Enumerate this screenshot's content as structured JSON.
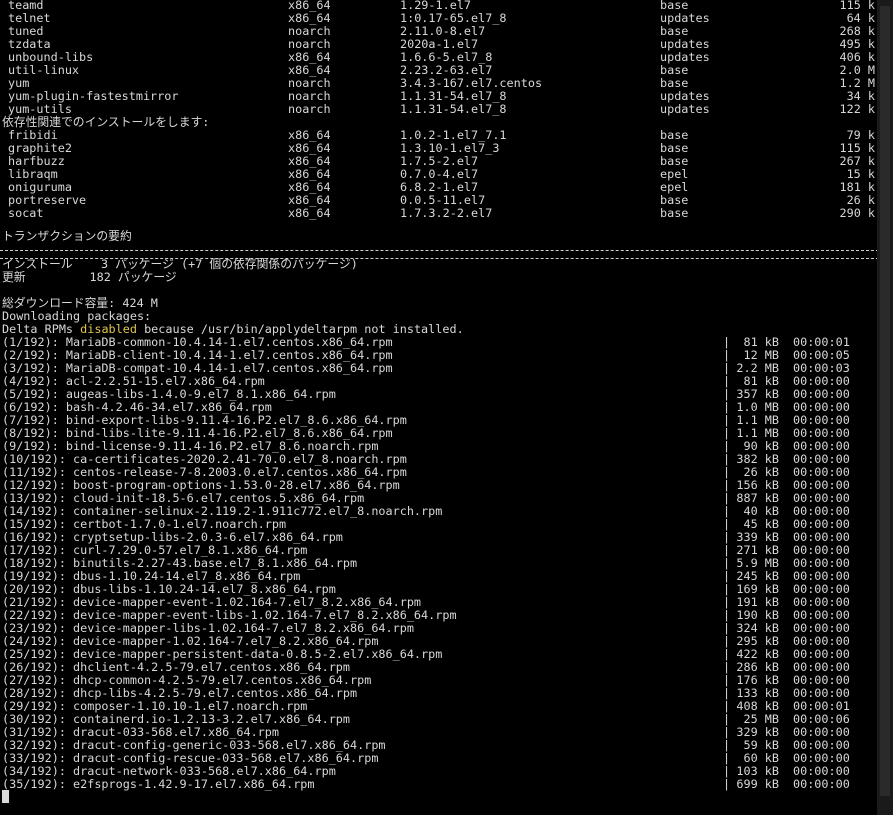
{
  "pkg_rows": [
    {
      "name": "teamd",
      "arch": "x86_64",
      "ver": "1.29-1.el7",
      "repo": "base",
      "size": "115 k"
    },
    {
      "name": "telnet",
      "arch": "x86_64",
      "ver": "1:0.17-65.el7_8",
      "repo": "updates",
      "size": "64 k"
    },
    {
      "name": "tuned",
      "arch": "noarch",
      "ver": "2.11.0-8.el7",
      "repo": "base",
      "size": "268 k"
    },
    {
      "name": "tzdata",
      "arch": "noarch",
      "ver": "2020a-1.el7",
      "repo": "updates",
      "size": "495 k"
    },
    {
      "name": "unbound-libs",
      "arch": "x86_64",
      "ver": "1.6.6-5.el7_8",
      "repo": "updates",
      "size": "406 k"
    },
    {
      "name": "util-linux",
      "arch": "x86_64",
      "ver": "2.23.2-63.el7",
      "repo": "base",
      "size": "2.0 M"
    },
    {
      "name": "yum",
      "arch": "noarch",
      "ver": "3.4.3-167.el7.centos",
      "repo": "base",
      "size": "1.2 M"
    },
    {
      "name": "yum-plugin-fastestmirror",
      "arch": "noarch",
      "ver": "1.1.31-54.el7_8",
      "repo": "updates",
      "size": "34 k"
    },
    {
      "name": "yum-utils",
      "arch": "noarch",
      "ver": "1.1.31-54.el7_8",
      "repo": "updates",
      "size": "122 k"
    }
  ],
  "deps_header": "依存性関連でのインストールをします:",
  "dep_rows": [
    {
      "name": "fribidi",
      "arch": "x86_64",
      "ver": "1.0.2-1.el7_7.1",
      "repo": "base",
      "size": "79 k"
    },
    {
      "name": "graphite2",
      "arch": "x86_64",
      "ver": "1.3.10-1.el7_3",
      "repo": "base",
      "size": "115 k"
    },
    {
      "name": "harfbuzz",
      "arch": "x86_64",
      "ver": "1.7.5-2.el7",
      "repo": "base",
      "size": "267 k"
    },
    {
      "name": "libraqm",
      "arch": "x86_64",
      "ver": "0.7.0-4.el7",
      "repo": "epel",
      "size": "15 k"
    },
    {
      "name": "oniguruma",
      "arch": "x86_64",
      "ver": "6.8.2-1.el7",
      "repo": "epel",
      "size": "181 k"
    },
    {
      "name": "portreserve",
      "arch": "x86_64",
      "ver": "0.0.5-11.el7",
      "repo": "base",
      "size": "26 k"
    },
    {
      "name": "socat",
      "arch": "x86_64",
      "ver": "1.7.3.2-2.el7",
      "repo": "base",
      "size": "290 k"
    }
  ],
  "summary_title": "トランザクションの要約",
  "summary_install": "インストール    3 パッケージ (+7 個の依存関係のパッケージ)",
  "summary_update": "更新         182 パッケージ",
  "total_download": "総ダウンロード容量: 424 M",
  "downloading": "Downloading packages:",
  "delta_pre": "Delta RPMs ",
  "delta_hi": "disabled",
  "delta_post": " because /usr/bin/applydeltarpm not installed.",
  "downloads": [
    {
      "n": "(1/192): MariaDB-common-10.4.14-1.el7.centos.x86_64.rpm",
      "s": "81 kB",
      "t": "00:00:01"
    },
    {
      "n": "(2/192): MariaDB-client-10.4.14-1.el7.centos.x86_64.rpm",
      "s": "12 MB",
      "t": "00:00:05"
    },
    {
      "n": "(3/192): MariaDB-compat-10.4.14-1.el7.centos.x86_64.rpm",
      "s": "2.2 MB",
      "t": "00:00:03"
    },
    {
      "n": "(4/192): acl-2.2.51-15.el7.x86_64.rpm",
      "s": "81 kB",
      "t": "00:00:00"
    },
    {
      "n": "(5/192): augeas-libs-1.4.0-9.el7_8.1.x86_64.rpm",
      "s": "357 kB",
      "t": "00:00:00"
    },
    {
      "n": "(6/192): bash-4.2.46-34.el7.x86_64.rpm",
      "s": "1.0 MB",
      "t": "00:00:00"
    },
    {
      "n": "(7/192): bind-export-libs-9.11.4-16.P2.el7_8.6.x86_64.rpm",
      "s": "1.1 MB",
      "t": "00:00:00"
    },
    {
      "n": "(8/192): bind-libs-lite-9.11.4-16.P2.el7_8.6.x86_64.rpm",
      "s": "1.1 MB",
      "t": "00:00:00"
    },
    {
      "n": "(9/192): bind-license-9.11.4-16.P2.el7_8.6.noarch.rpm",
      "s": "90 kB",
      "t": "00:00:00"
    },
    {
      "n": "(10/192): ca-certificates-2020.2.41-70.0.el7_8.noarch.rpm",
      "s": "382 kB",
      "t": "00:00:00"
    },
    {
      "n": "(11/192): centos-release-7-8.2003.0.el7.centos.x86_64.rpm",
      "s": "26 kB",
      "t": "00:00:00"
    },
    {
      "n": "(12/192): boost-program-options-1.53.0-28.el7.x86_64.rpm",
      "s": "156 kB",
      "t": "00:00:00"
    },
    {
      "n": "(13/192): cloud-init-18.5-6.el7.centos.5.x86_64.rpm",
      "s": "887 kB",
      "t": "00:00:00"
    },
    {
      "n": "(14/192): container-selinux-2.119.2-1.911c772.el7_8.noarch.rpm",
      "s": "40 kB",
      "t": "00:00:00"
    },
    {
      "n": "(15/192): certbot-1.7.0-1.el7.noarch.rpm",
      "s": "45 kB",
      "t": "00:00:00"
    },
    {
      "n": "(16/192): cryptsetup-libs-2.0.3-6.el7.x86_64.rpm",
      "s": "339 kB",
      "t": "00:00:00"
    },
    {
      "n": "(17/192): curl-7.29.0-57.el7_8.1.x86_64.rpm",
      "s": "271 kB",
      "t": "00:00:00"
    },
    {
      "n": "(18/192): binutils-2.27-43.base.el7_8.1.x86_64.rpm",
      "s": "5.9 MB",
      "t": "00:00:00"
    },
    {
      "n": "(19/192): dbus-1.10.24-14.el7_8.x86_64.rpm",
      "s": "245 kB",
      "t": "00:00:00"
    },
    {
      "n": "(20/192): dbus-libs-1.10.24-14.el7_8.x86_64.rpm",
      "s": "169 kB",
      "t": "00:00:00"
    },
    {
      "n": "(21/192): device-mapper-event-1.02.164-7.el7_8.2.x86_64.rpm",
      "s": "191 kB",
      "t": "00:00:00"
    },
    {
      "n": "(22/192): device-mapper-event-libs-1.02.164-7.el7_8.2.x86_64.rpm",
      "s": "190 kB",
      "t": "00:00:00"
    },
    {
      "n": "(23/192): device-mapper-libs-1.02.164-7.el7_8.2.x86_64.rpm",
      "s": "324 kB",
      "t": "00:00:00"
    },
    {
      "n": "(24/192): device-mapper-1.02.164-7.el7_8.2.x86_64.rpm",
      "s": "295 kB",
      "t": "00:00:00"
    },
    {
      "n": "(25/192): device-mapper-persistent-data-0.8.5-2.el7.x86_64.rpm",
      "s": "422 kB",
      "t": "00:00:00"
    },
    {
      "n": "(26/192): dhclient-4.2.5-79.el7.centos.x86_64.rpm",
      "s": "286 kB",
      "t": "00:00:00"
    },
    {
      "n": "(27/192): dhcp-common-4.2.5-79.el7.centos.x86_64.rpm",
      "s": "176 kB",
      "t": "00:00:00"
    },
    {
      "n": "(28/192): dhcp-libs-4.2.5-79.el7.centos.x86_64.rpm",
      "s": "133 kB",
      "t": "00:00:00"
    },
    {
      "n": "(29/192): composer-1.10.10-1.el7.noarch.rpm",
      "s": "408 kB",
      "t": "00:00:01"
    },
    {
      "n": "(30/192): containerd.io-1.2.13-3.2.el7.x86_64.rpm",
      "s": "25 MB",
      "t": "00:00:06"
    },
    {
      "n": "(31/192): dracut-033-568.el7.x86_64.rpm",
      "s": "329 kB",
      "t": "00:00:00"
    },
    {
      "n": "(32/192): dracut-config-generic-033-568.el7.x86_64.rpm",
      "s": "59 kB",
      "t": "00:00:00"
    },
    {
      "n": "(33/192): dracut-config-rescue-033-568.el7.x86_64.rpm",
      "s": "60 kB",
      "t": "00:00:00"
    },
    {
      "n": "(34/192): dracut-network-033-568.el7.x86_64.rpm",
      "s": "103 kB",
      "t": "00:00:00"
    },
    {
      "n": "(35/192): e2fsprogs-1.42.9-17.el7.x86_64.rpm",
      "s": "699 kB",
      "t": "00:00:00"
    }
  ],
  "colors": {
    "background": "#000000",
    "text": "#d8d8d8",
    "highlight": "#e0c64f"
  }
}
